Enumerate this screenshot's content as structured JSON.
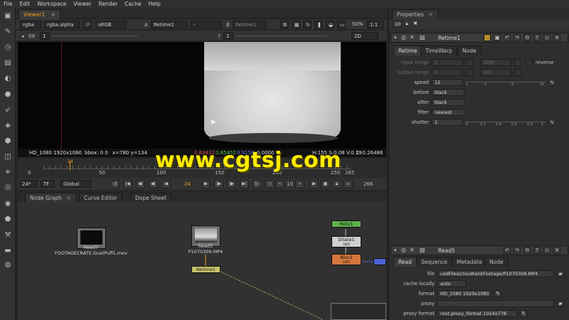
{
  "menu": [
    "File",
    "Edit",
    "Workspace",
    "Viewer",
    "Render",
    "Cache",
    "Help"
  ],
  "viewer": {
    "tab": "Viewer1",
    "channels": "rgba",
    "alpha": "rgba.alpha",
    "ip": "IP",
    "lut": "sRGB",
    "a_label": "A",
    "a_input": "Retime1",
    "a_op": "-",
    "b_label": "B",
    "b_input": "Retime1",
    "zoom": "50%",
    "ratio": "1:1",
    "fstop": "f/8",
    "frame_gain": "1",
    "gamma": "Y",
    "gamma_val": "1",
    "view_mode": "2D",
    "info_format": "HD_1080 1920x1080",
    "info_bbox": "bbox: 0 0",
    "info_xy": "x=780 y=134",
    "info_vals": [
      "0.83432",
      "0.85452",
      "0.9158",
      "0.0000"
    ],
    "info_hsv": "H:155 S:0.08 V:0.29",
    "info_l": "L: 0.26486"
  },
  "timeline": {
    "ticks": [
      "0",
      "50",
      "100",
      "150",
      "200",
      "250",
      "265"
    ],
    "current_marker": "24",
    "fps": "24*",
    "tf": "TF",
    "scope": "Global",
    "current_frame": "24",
    "step": "10",
    "end_frame": "266"
  },
  "panels": {
    "tabs": [
      "Node Graph",
      "Curve Editor",
      "Dope Sheet"
    ]
  },
  "nodes": {
    "read7_name": "Read7",
    "read7_file": "FOOTAGECRATE-DustPuff1.mov",
    "read5_name": "Read5",
    "read5_file": "P1070309.MP4",
    "retime_name": "Retime1",
    "roto_name": "Roto1",
    "dilate_name": "Dilate1",
    "dilate_sub": "(all)",
    "blur_name": "Blur2",
    "blur_sub": "(all)"
  },
  "properties": {
    "title": "Properties",
    "max_panels": "10",
    "retime": {
      "name": "Retime1",
      "tabs": [
        "Retime",
        "TimeWarp",
        "Node"
      ],
      "input_range_label": "input range",
      "input_start": "1",
      "input_end": "1950",
      "reverse_label": "reverse",
      "output_range_label": "output range",
      "output_start": "1",
      "output_end": "163",
      "speed_label": "speed",
      "speed": "12",
      "speed_ticks": [
        "1",
        "2",
        "5",
        "10"
      ],
      "before_label": "before",
      "before": "black",
      "after_label": "after",
      "after": "black",
      "filter_label": "filter",
      "filter": "nearest",
      "shutter_label": "shutter",
      "shutter": "1",
      "shutter_ticks": [
        "0",
        "0.2",
        "0.4",
        "0.6",
        "0.8",
        "1"
      ]
    },
    "read": {
      "name": "Read5",
      "tabs": [
        "Read",
        "Sequence",
        "Metadata",
        "Node"
      ],
      "file_label": "file",
      "file": "cedFiles/cloudtankFootage/P1070309.MP4",
      "cache_label": "cache locally",
      "cache": "auto",
      "format_label": "format",
      "format": "HD_1080 1920x1080",
      "proxy_label": "proxy",
      "proxy": "",
      "proxy_format_label": "proxy format",
      "proxy_format": "root.proxy_format 1024x778"
    }
  },
  "watermark": "www.cgtsj.com",
  "colors": {
    "accent_orange": "#f29a1c",
    "roto_node": "#5fb04a",
    "dilate_node": "#cfcfcf",
    "blur_node": "#d3753c",
    "retime_node": "#c8c26a",
    "watermark": "#ffeb00"
  }
}
